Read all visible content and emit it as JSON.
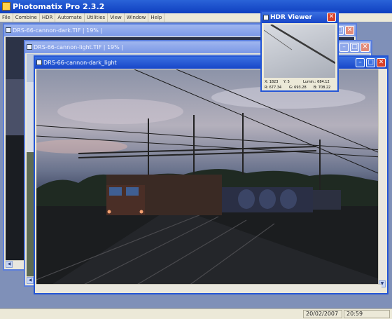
{
  "app": {
    "title": "Photomatix Pro 2.3.2"
  },
  "menu": [
    "File",
    "Combine",
    "HDR",
    "Automate",
    "Utilities",
    "View",
    "Window",
    "Help"
  ],
  "windows": {
    "w1": {
      "title": "DRS-66-cannon-dark.TIF | 19% |"
    },
    "w2": {
      "title": "DRS-66-cannon-light.TIF | 19% |"
    },
    "w3": {
      "title": "DRS-66-cannon-dark_light"
    }
  },
  "viewer": {
    "title": "HDR Viewer",
    "x": "X: 1823",
    "y": "Y: 5",
    "lumin": "Lumin.: 684.12",
    "r": "R: 677.34",
    "g": "G: 693.28",
    "b": "B: 708.22"
  },
  "status": {
    "date": "20/02/2007",
    "time": "20:59"
  },
  "colors": {
    "title_bar": "#0f3fc0",
    "active_window": "#2456d6",
    "close": "#d9412a",
    "workspace": "#7f90b8"
  }
}
